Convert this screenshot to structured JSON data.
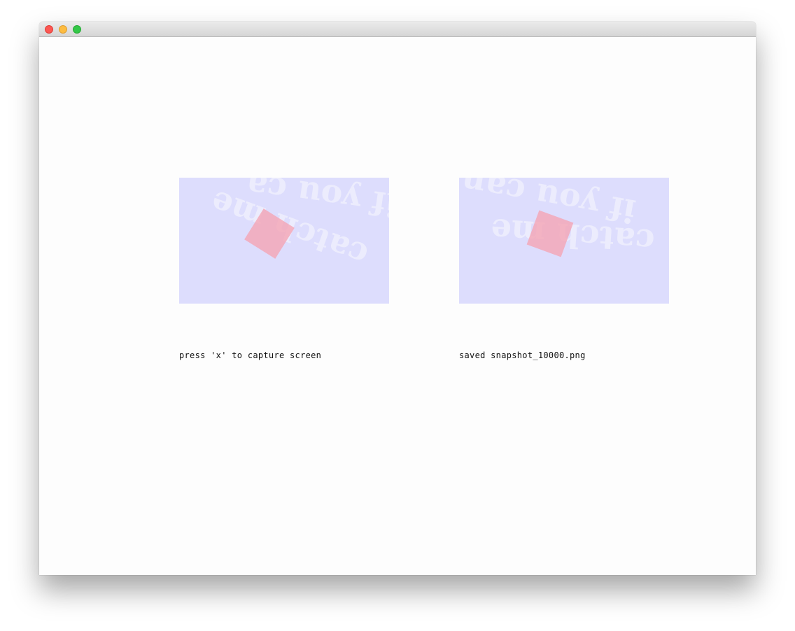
{
  "window": {
    "controls": {
      "close_color": "#fc5753",
      "minimize_color": "#fdbc40",
      "maximize_color": "#33c748"
    }
  },
  "panels": {
    "background_color": "#ddddfd",
    "square_color": "#f5a0af",
    "left": {
      "text_line_1": "if you ca",
      "text_line_2": "catch me"
    },
    "right": {
      "text_line_1": "if you can",
      "text_line_2": "catch me"
    }
  },
  "captions": {
    "left": "press 'x' to capture screen",
    "right": "saved snapshot_10000.png"
  }
}
